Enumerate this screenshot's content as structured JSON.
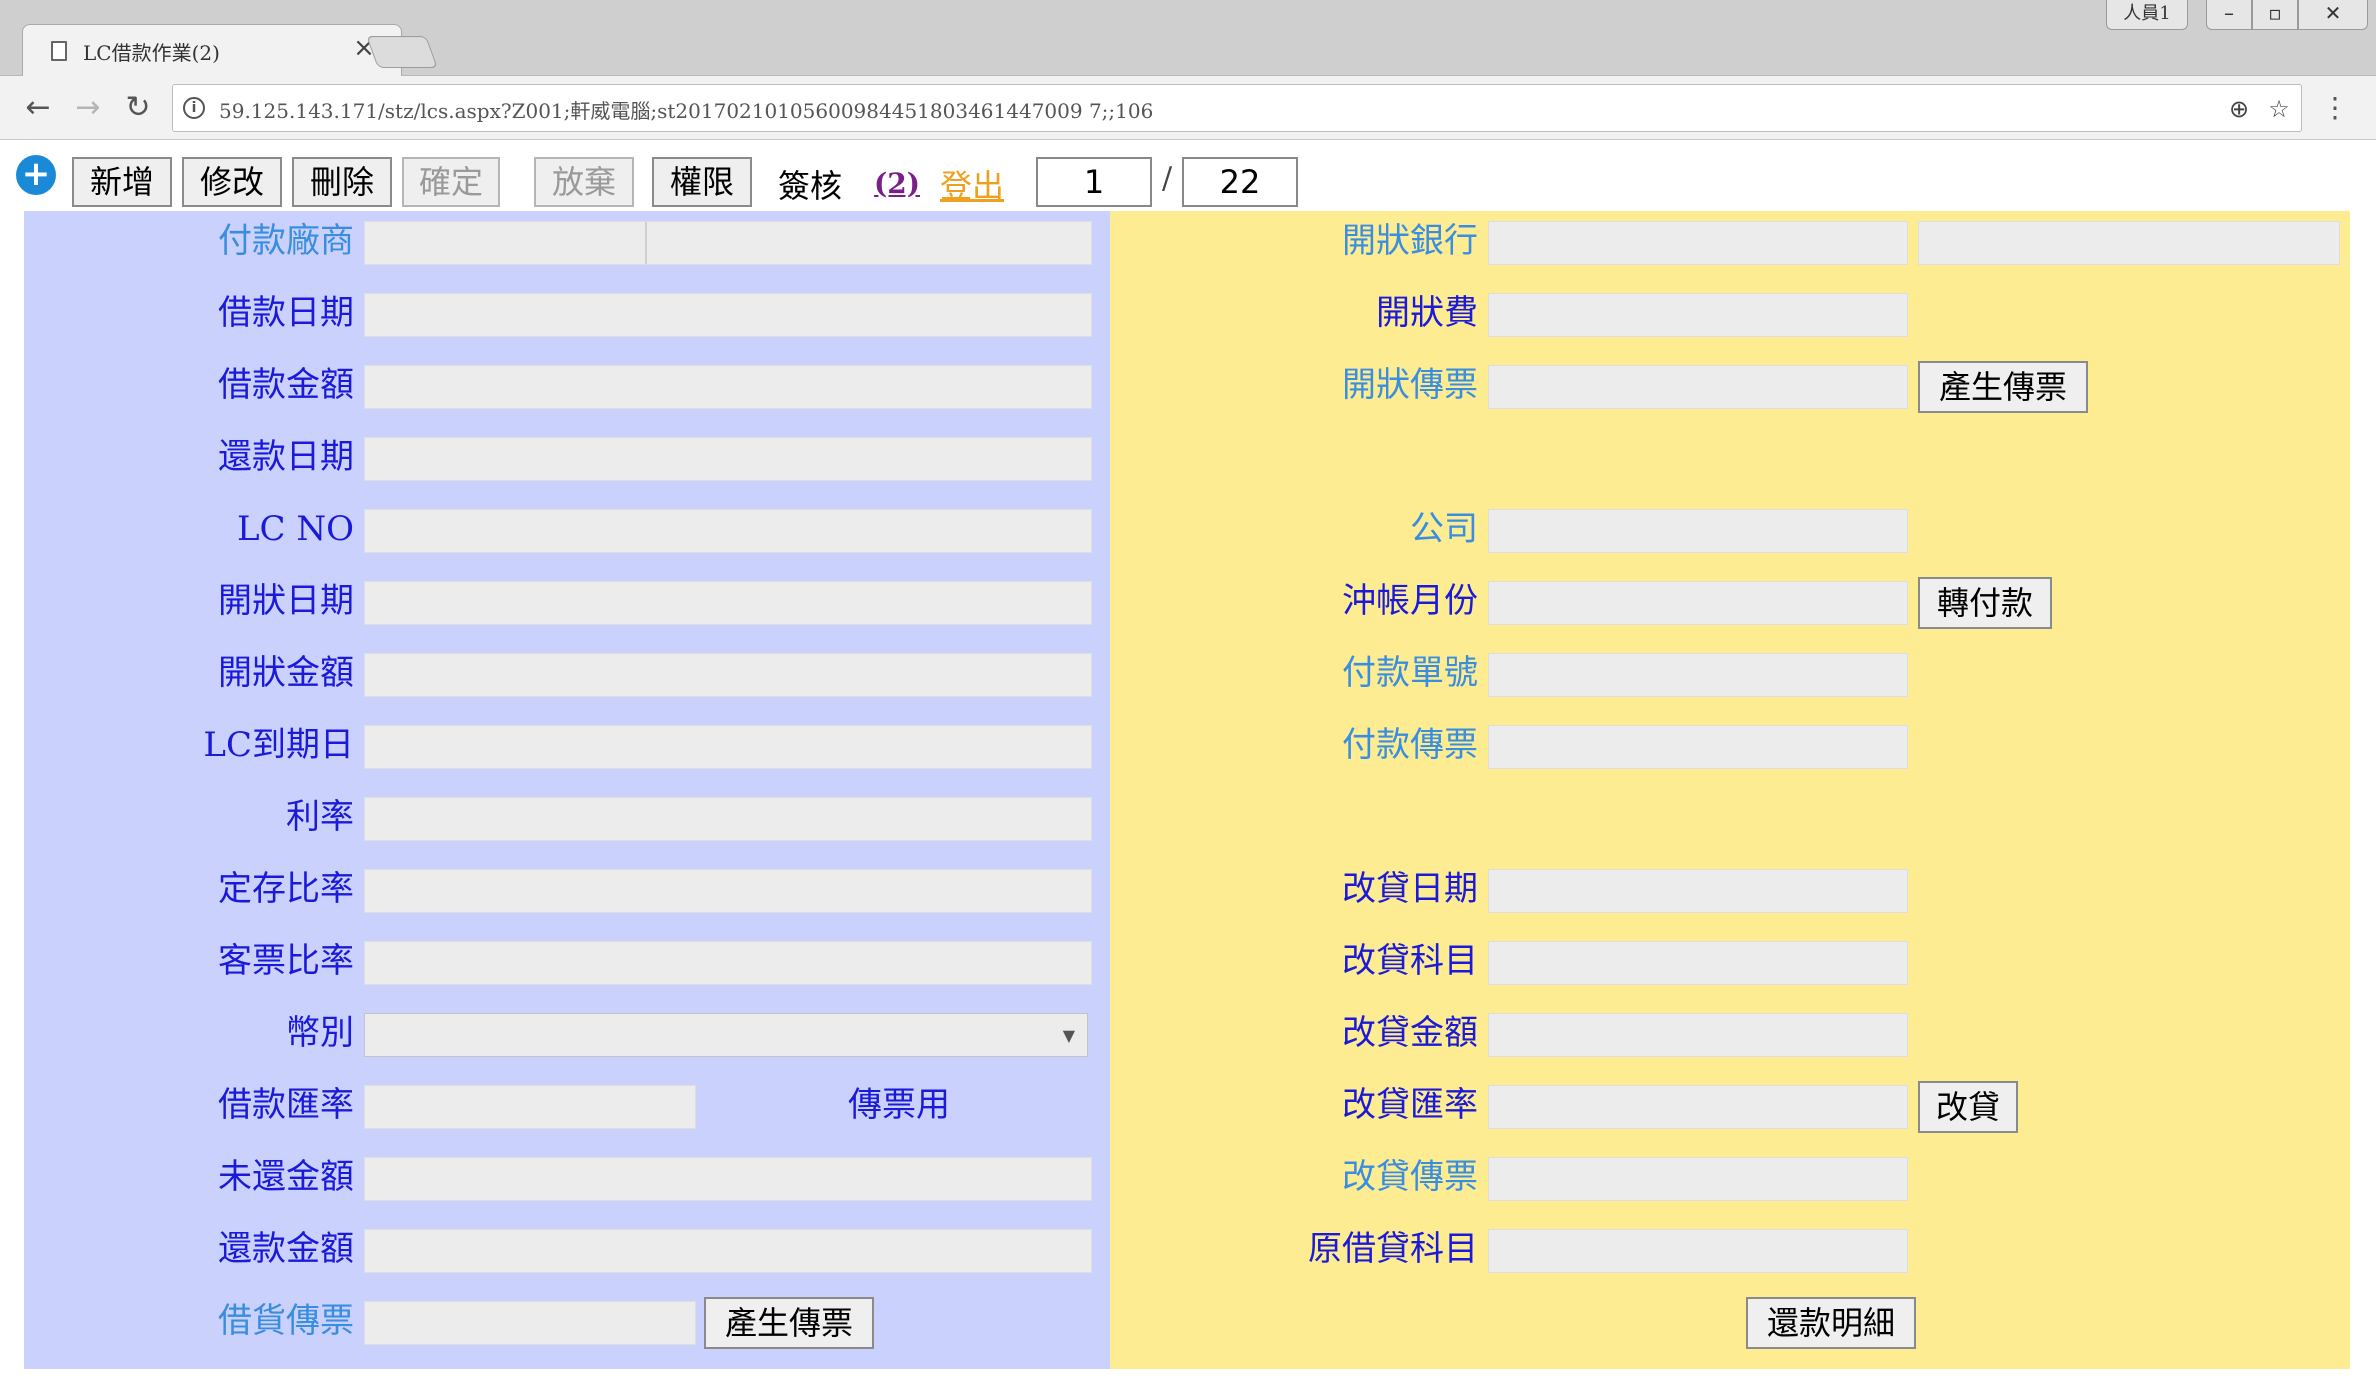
{
  "browser": {
    "tab_title": "LC借款作業(2)",
    "tab_close": "×",
    "user_badge": "人員1",
    "url": "59.125.143.171/stz/lcs.aspx?Z001;軒威電腦;st20170210105600984451803461447009 7;;106",
    "icons": {
      "back": "←",
      "forward": "→",
      "reload": "↻",
      "zoom": "⊕",
      "star": "☆",
      "menu": "⋮",
      "info": "i"
    },
    "window": {
      "minimize": "–",
      "maximize": "▫",
      "close": "✕"
    }
  },
  "toolbar": {
    "add_label": "新增",
    "edit_label": "修改",
    "delete_label": "刪除",
    "confirm_label": "確定",
    "cancel_label": "放棄",
    "permission_label": "權限",
    "sign_label": "簽核",
    "sign_count": "(2)",
    "logout_label": "登出",
    "page_current": "1",
    "page_separator": "/",
    "page_total": "22",
    "plus_icon": "+"
  },
  "left_form": {
    "vendor": "付款廠商",
    "loan_date": "借款日期",
    "loan_amount": "借款金額",
    "repay_date": "還款日期",
    "lc_no": "LC NO",
    "open_date": "開狀日期",
    "open_amount": "開狀金額",
    "lc_expiry": "LC到期日",
    "interest_rate": "利率",
    "deposit_ratio": "定存比率",
    "customer_bill_ratio": "客票比率",
    "currency": "幣別",
    "loan_rate": "借款匯率",
    "voucher_use": "傳票用",
    "unpaid_amount": "未還金額",
    "repaid_amount": "還款金額",
    "loan_voucher": "借貨傳票",
    "gen_voucher_btn": "產生傳票",
    "select_arrow": "▼"
  },
  "right_form": {
    "open_bank": "開狀銀行",
    "open_fee": "開狀費",
    "open_voucher": "開狀傳票",
    "gen_voucher_btn": "產生傳票",
    "company": "公司",
    "writeoff_month": "沖帳月份",
    "transfer_payment_btn": "轉付款",
    "payment_no": "付款單號",
    "payment_voucher": "付款傳票",
    "reloan_date": "改貸日期",
    "reloan_account": "改貸科目",
    "reloan_amount": "改貸金額",
    "reloan_rate": "改貸匯率",
    "reloan_btn": "改貸",
    "reloan_voucher": "改貸傳票",
    "original_loan_account": "原借貸科目",
    "repay_detail_btn": "還款明細"
  }
}
